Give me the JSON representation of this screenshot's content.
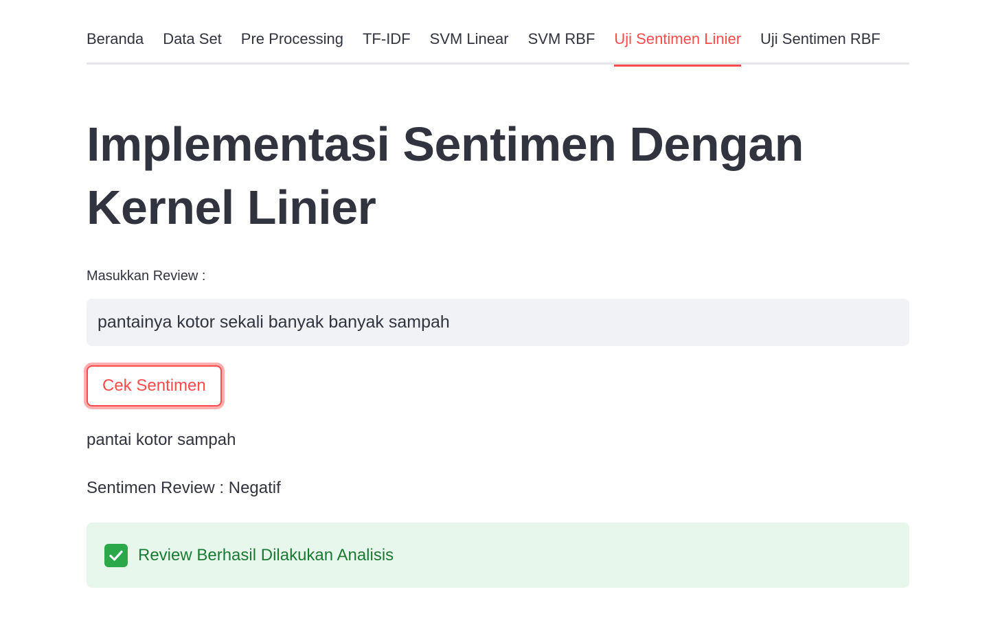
{
  "tabs": [
    {
      "label": "Beranda",
      "active": false
    },
    {
      "label": "Data Set",
      "active": false
    },
    {
      "label": "Pre Processing",
      "active": false
    },
    {
      "label": "TF-IDF",
      "active": false
    },
    {
      "label": "SVM Linear",
      "active": false
    },
    {
      "label": "SVM RBF",
      "active": false
    },
    {
      "label": "Uji Sentimen Linier",
      "active": true
    },
    {
      "label": "Uji Sentimen RBF",
      "active": false
    }
  ],
  "page": {
    "title": "Implementasi Sentimen Dengan Kernel Linier"
  },
  "form": {
    "review_label": "Masukkan Review :",
    "review_value": "pantainya kotor sekali banyak banyak sampah",
    "submit_label": "Cek Sentimen"
  },
  "result": {
    "processed_text": "pantai kotor sampah",
    "sentiment_line": "Sentimen Review : Negatif",
    "success_message": "Review Berhasil Dilakukan Analisis",
    "success_icon": "check-mark-icon"
  },
  "colors": {
    "accent": "#ff4b4b",
    "text": "#31333f",
    "input_bg": "#f0f2f6",
    "success_bg": "#e8f7ec",
    "success_text": "#1a7a33"
  }
}
